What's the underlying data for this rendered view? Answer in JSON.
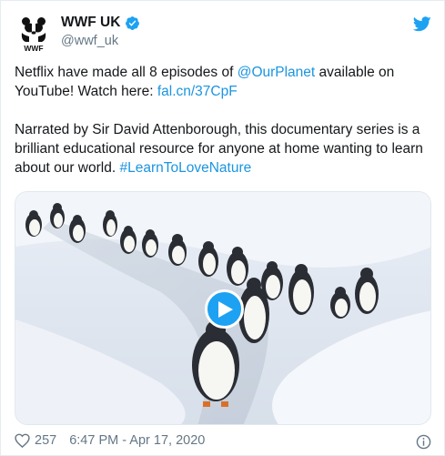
{
  "tweet": {
    "display_name": "WWF UK",
    "handle": "@wwf_uk",
    "avatar_logo_text": "WWF",
    "text1_part1": "Netflix have made all 8 episodes of ",
    "text1_mention": "@OurPlanet",
    "text1_part2": " available on YouTube! Watch here: ",
    "text1_link": "fal.cn/37CpF",
    "text2_part1": "Narrated by Sir David Attenborough, this documentary series is a brilliant educational resource for anyone at home wanting to learn about our world. ",
    "text2_hashtag": "#LearnToLoveNature"
  },
  "footer": {
    "likes": "257",
    "timestamp": "6:47 PM - Apr 17, 2020"
  },
  "colors": {
    "link": "#1b95e0",
    "brand_blue": "#1da1f2",
    "secondary_text": "#657786"
  },
  "icons": {
    "verified": "verified-badge-icon",
    "twitter": "twitter-bird-icon",
    "play": "play-icon",
    "like": "heart-icon",
    "info": "info-icon"
  }
}
